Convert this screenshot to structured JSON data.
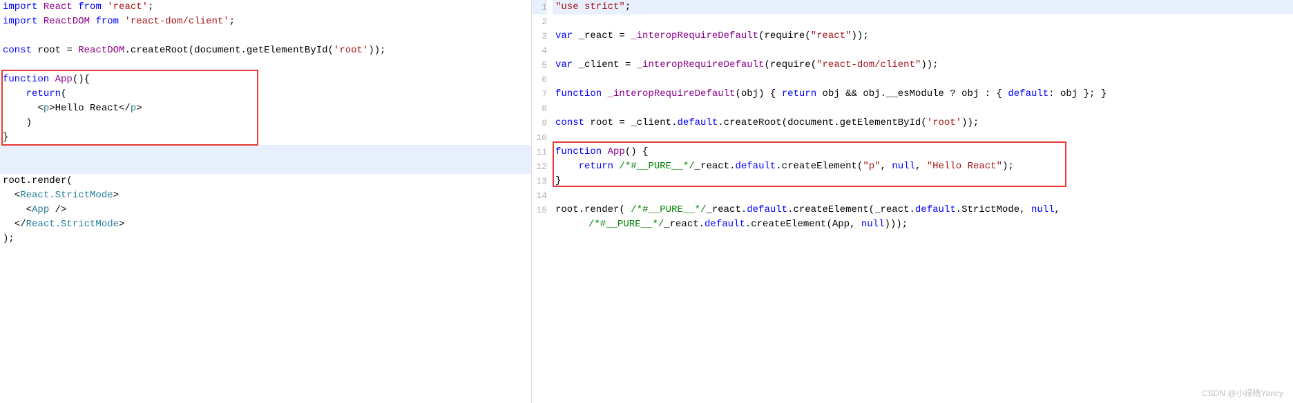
{
  "watermark": "CSDN @小绿杨Yancy",
  "left": {
    "lines": [
      {
        "hl": false,
        "tokens": [
          [
            "kw",
            "import"
          ],
          [
            "",
            " "
          ],
          [
            "fn",
            "React"
          ],
          [
            "",
            " "
          ],
          [
            "kw",
            "from"
          ],
          [
            "",
            " "
          ],
          [
            "str",
            "'react'"
          ],
          [
            "",
            ";"
          ]
        ]
      },
      {
        "hl": false,
        "tokens": [
          [
            "kw",
            "import"
          ],
          [
            "",
            " "
          ],
          [
            "fn",
            "ReactDOM"
          ],
          [
            "",
            " "
          ],
          [
            "kw",
            "from"
          ],
          [
            "",
            " "
          ],
          [
            "str",
            "'react-dom/client'"
          ],
          [
            "",
            ";"
          ]
        ]
      },
      {
        "hl": false,
        "tokens": [
          [
            "",
            ""
          ]
        ]
      },
      {
        "hl": false,
        "tokens": [
          [
            "kw",
            "const"
          ],
          [
            "",
            " "
          ],
          [
            "ident",
            "root"
          ],
          [
            "",
            " = "
          ],
          [
            "fn",
            "ReactDOM"
          ],
          [
            "",
            ".createRoot(document.getElementById("
          ],
          [
            "str",
            "'root'"
          ],
          [
            "",
            "));"
          ]
        ]
      },
      {
        "hl": false,
        "tokens": [
          [
            "",
            ""
          ]
        ]
      },
      {
        "hl": false,
        "tokens": [
          [
            "kw",
            "function"
          ],
          [
            "",
            " "
          ],
          [
            "fn",
            "App"
          ],
          [
            "",
            "(){"
          ]
        ]
      },
      {
        "hl": false,
        "tokens": [
          [
            "",
            "    "
          ],
          [
            "kw",
            "return"
          ],
          [
            "",
            "("
          ]
        ]
      },
      {
        "hl": false,
        "tokens": [
          [
            "",
            "      <"
          ],
          [
            "jsx-tag",
            "p"
          ],
          [
            "",
            ">Hello React</"
          ],
          [
            "jsx-tag",
            "p"
          ],
          [
            "",
            ">"
          ]
        ]
      },
      {
        "hl": false,
        "tokens": [
          [
            "",
            "    )"
          ]
        ]
      },
      {
        "hl": false,
        "tokens": [
          [
            "",
            "}"
          ]
        ]
      },
      {
        "hl": true,
        "tokens": [
          [
            "",
            ""
          ]
        ]
      },
      {
        "hl": true,
        "tokens": [
          [
            "",
            ""
          ]
        ]
      },
      {
        "hl": false,
        "tokens": [
          [
            "ident",
            "root"
          ],
          [
            "",
            ".render("
          ]
        ]
      },
      {
        "hl": false,
        "tokens": [
          [
            "",
            "  <"
          ],
          [
            "jsx-tag",
            "React.StrictMode"
          ],
          [
            "",
            ">"
          ]
        ]
      },
      {
        "hl": false,
        "tokens": [
          [
            "",
            "    <"
          ],
          [
            "jsx-tag",
            "App"
          ],
          [
            "",
            " />"
          ]
        ]
      },
      {
        "hl": false,
        "tokens": [
          [
            "",
            "  </"
          ],
          [
            "jsx-tag",
            "React.StrictMode"
          ],
          [
            "",
            ">"
          ]
        ]
      },
      {
        "hl": false,
        "tokens": [
          [
            "",
            ");"
          ]
        ]
      }
    ]
  },
  "right": {
    "lines": [
      {
        "n": 1,
        "hl": true,
        "tokens": [
          [
            "str",
            "\"use strict\""
          ],
          [
            "",
            ";"
          ]
        ]
      },
      {
        "n": 2,
        "hl": false,
        "tokens": [
          [
            "",
            ""
          ]
        ]
      },
      {
        "n": 3,
        "hl": false,
        "tokens": [
          [
            "kw",
            "var"
          ],
          [
            "",
            " _react = "
          ],
          [
            "fn",
            "_interopRequireDefault"
          ],
          [
            "",
            "(require("
          ],
          [
            "str",
            "\"react\""
          ],
          [
            "",
            "));"
          ]
        ]
      },
      {
        "n": 4,
        "hl": false,
        "tokens": [
          [
            "",
            ""
          ]
        ]
      },
      {
        "n": 5,
        "hl": false,
        "tokens": [
          [
            "kw",
            "var"
          ],
          [
            "",
            " _client = "
          ],
          [
            "fn",
            "_interopRequireDefault"
          ],
          [
            "",
            "(require("
          ],
          [
            "str",
            "\"react-dom/client\""
          ],
          [
            "",
            "));"
          ]
        ]
      },
      {
        "n": 6,
        "hl": false,
        "tokens": [
          [
            "",
            ""
          ]
        ]
      },
      {
        "n": 7,
        "hl": false,
        "tokens": [
          [
            "kw",
            "function"
          ],
          [
            "",
            " "
          ],
          [
            "fn",
            "_interopRequireDefault"
          ],
          [
            "",
            "(obj) { "
          ],
          [
            "kw",
            "return"
          ],
          [
            "",
            " obj && obj.__esModule ? obj : { "
          ],
          [
            "kw",
            "default"
          ],
          [
            "",
            ": obj }; }"
          ]
        ]
      },
      {
        "n": 8,
        "hl": false,
        "tokens": [
          [
            "",
            ""
          ]
        ]
      },
      {
        "n": 9,
        "hl": false,
        "tokens": [
          [
            "kw",
            "const"
          ],
          [
            "",
            " root = _client."
          ],
          [
            "kw",
            "default"
          ],
          [
            "",
            ".createRoot(document.getElementById("
          ],
          [
            "str",
            "'root'"
          ],
          [
            "",
            "));"
          ]
        ]
      },
      {
        "n": 10,
        "hl": false,
        "tokens": [
          [
            "",
            ""
          ]
        ]
      },
      {
        "n": 11,
        "hl": false,
        "tokens": [
          [
            "kw",
            "function"
          ],
          [
            "",
            " "
          ],
          [
            "fn",
            "App"
          ],
          [
            "",
            "() {"
          ]
        ]
      },
      {
        "n": 12,
        "hl": false,
        "tokens": [
          [
            "",
            "    "
          ],
          [
            "kw",
            "return"
          ],
          [
            "",
            " "
          ],
          [
            "comment",
            "/*#__PURE__*/"
          ],
          [
            "",
            "_react."
          ],
          [
            "kw",
            "default"
          ],
          [
            "",
            ".createElement("
          ],
          [
            "str",
            "\"p\""
          ],
          [
            "",
            ", "
          ],
          [
            "kw",
            "null"
          ],
          [
            "",
            ", "
          ],
          [
            "str",
            "\"Hello React\""
          ],
          [
            "",
            ");"
          ]
        ]
      },
      {
        "n": 13,
        "hl": false,
        "tokens": [
          [
            "",
            "}"
          ]
        ]
      },
      {
        "n": 14,
        "hl": false,
        "tokens": [
          [
            "",
            ""
          ]
        ]
      },
      {
        "n": 15,
        "hl": false,
        "tokens": [
          [
            "",
            "root.render( "
          ],
          [
            "comment",
            "/*#__PURE__*/"
          ],
          [
            "",
            "_react."
          ],
          [
            "kw",
            "default"
          ],
          [
            "",
            ".createElement(_react."
          ],
          [
            "kw",
            "default"
          ],
          [
            "",
            ".StrictMode, "
          ],
          [
            "kw",
            "null"
          ],
          [
            "",
            ","
          ]
        ]
      },
      {
        "n": 0,
        "cont": true,
        "hl": false,
        "tokens": [
          [
            "comment",
            "/*#__PURE__*/"
          ],
          [
            "",
            "_react."
          ],
          [
            "kw",
            "default"
          ],
          [
            "",
            ".createElement(App, "
          ],
          [
            "kw",
            "null"
          ],
          [
            "",
            ")));"
          ]
        ]
      }
    ]
  }
}
